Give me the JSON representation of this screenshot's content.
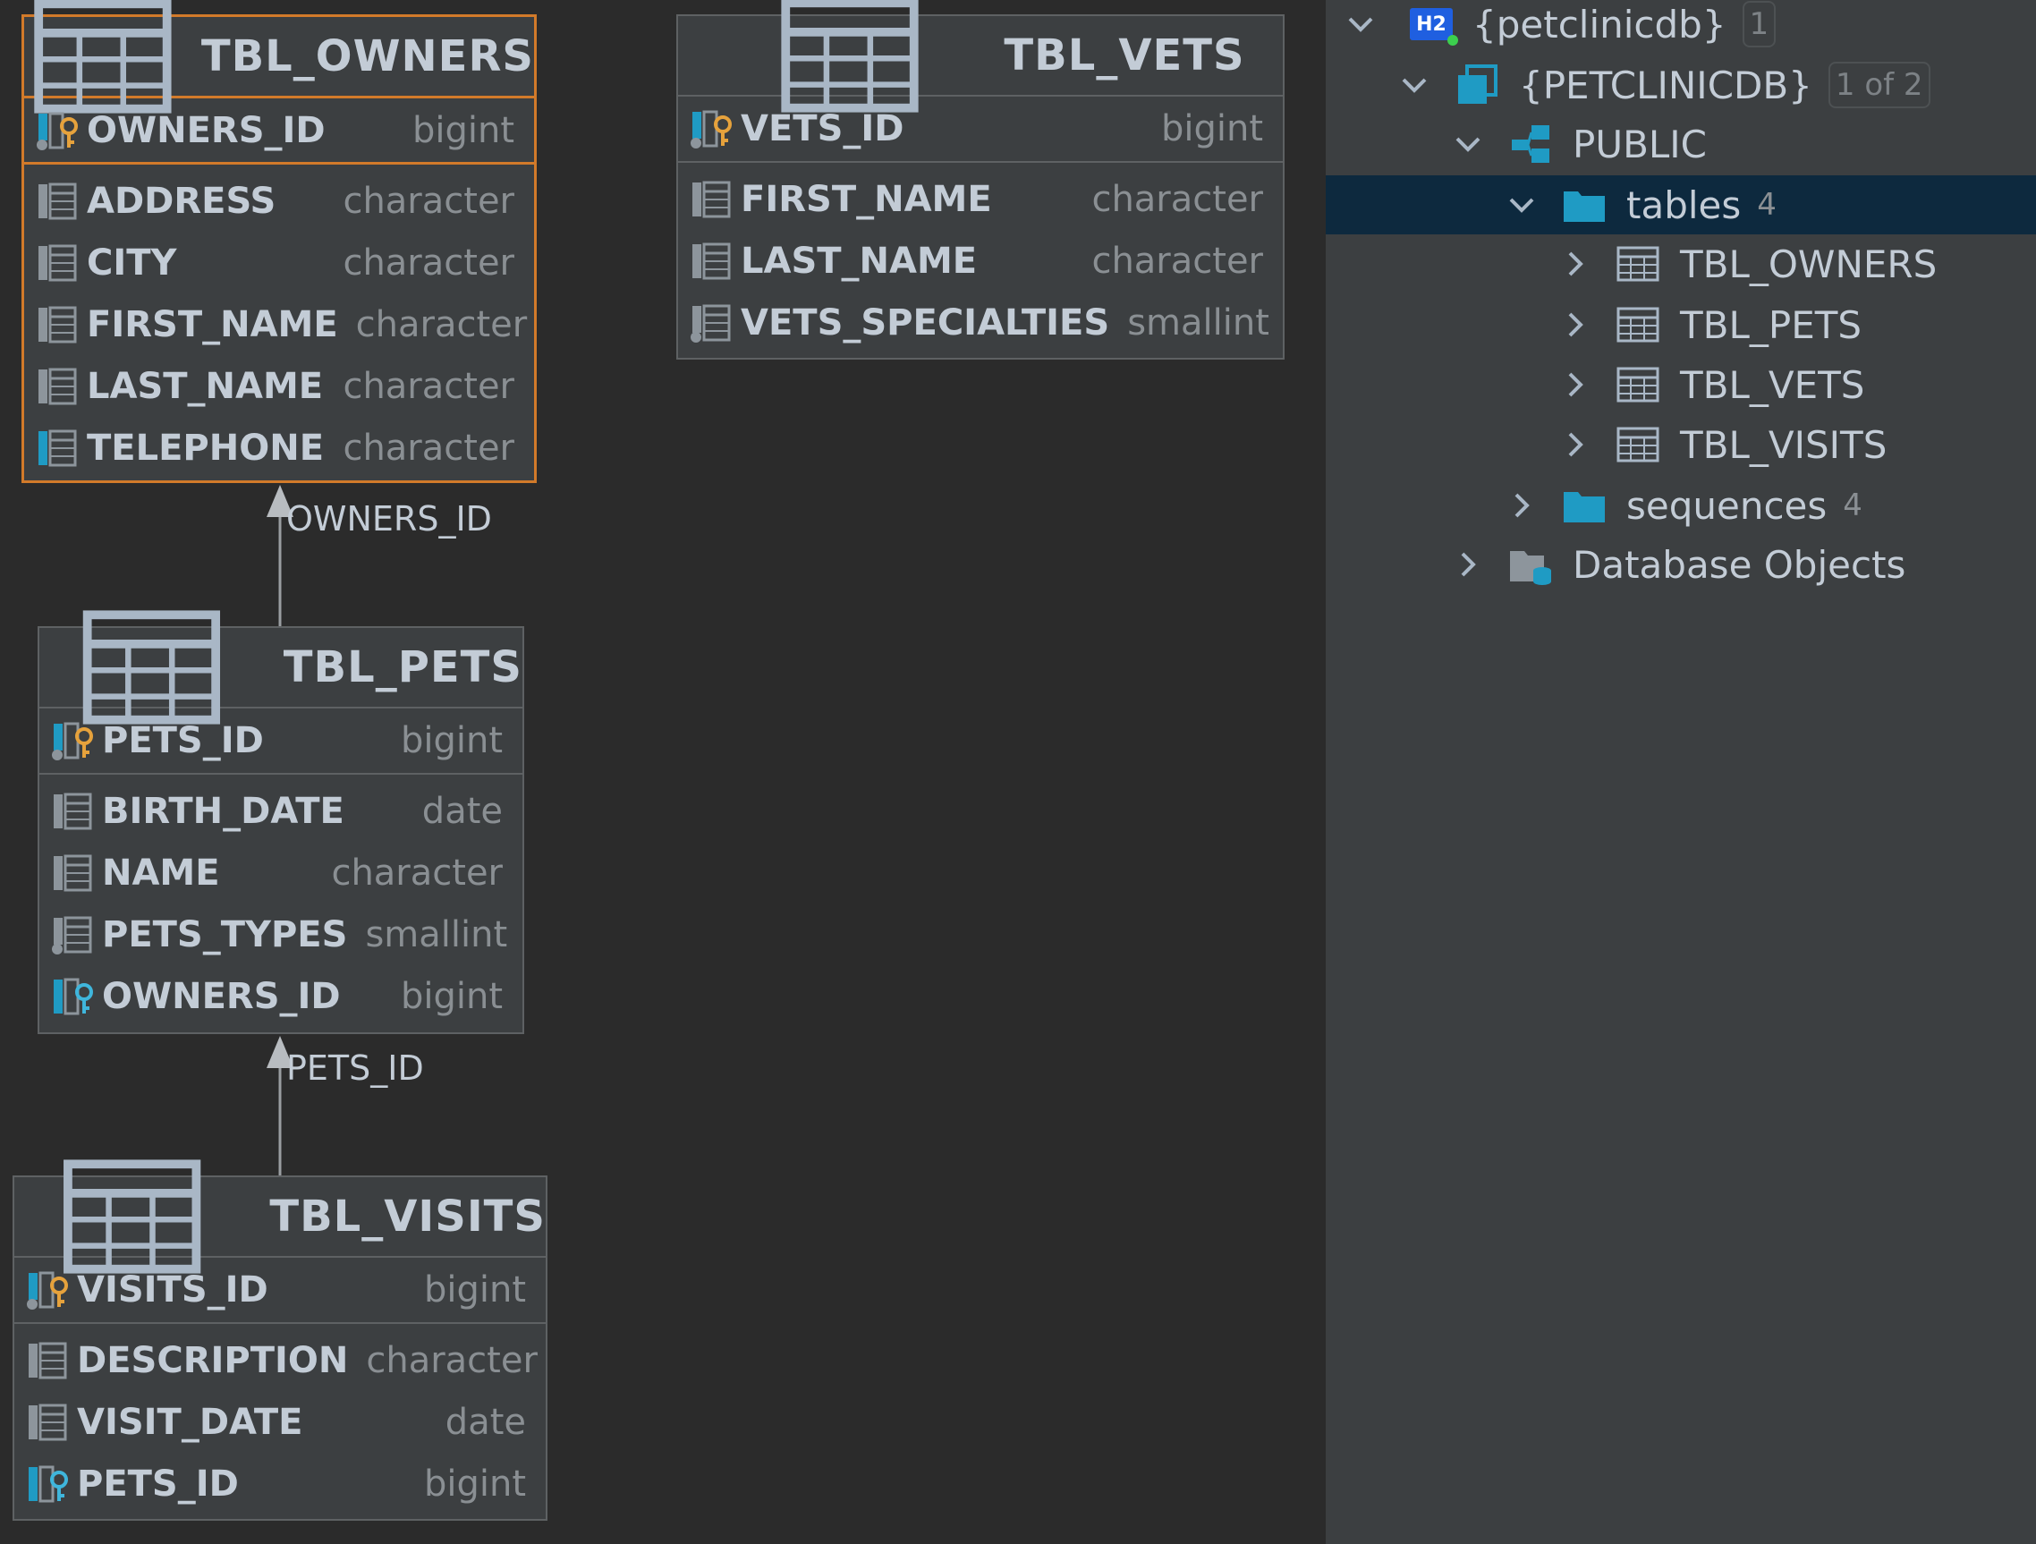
{
  "diagram": {
    "tables": {
      "owners": {
        "title": "TBL_OWNERS",
        "pk": {
          "name": "OWNERS_ID",
          "type": "bigint"
        },
        "columns": [
          {
            "name": "ADDRESS",
            "type": "character"
          },
          {
            "name": "CITY",
            "type": "character"
          },
          {
            "name": "FIRST_NAME",
            "type": "character"
          },
          {
            "name": "LAST_NAME",
            "type": "character"
          },
          {
            "name": "TELEPHONE",
            "type": "character"
          }
        ]
      },
      "vets": {
        "title": "TBL_VETS",
        "pk": {
          "name": "VETS_ID",
          "type": "bigint"
        },
        "columns": [
          {
            "name": "FIRST_NAME",
            "type": "character"
          },
          {
            "name": "LAST_NAME",
            "type": "character"
          },
          {
            "name": "VETS_SPECIALTIES",
            "type": "smallint"
          }
        ]
      },
      "pets": {
        "title": "TBL_PETS",
        "pk": {
          "name": "PETS_ID",
          "type": "bigint"
        },
        "columns": [
          {
            "name": "BIRTH_DATE",
            "type": "date"
          },
          {
            "name": "NAME",
            "type": "character"
          },
          {
            "name": "PETS_TYPES",
            "type": "smallint"
          },
          {
            "name": "OWNERS_ID",
            "type": "bigint"
          }
        ]
      },
      "visits": {
        "title": "TBL_VISITS",
        "pk": {
          "name": "VISITS_ID",
          "type": "bigint"
        },
        "columns": [
          {
            "name": "DESCRIPTION",
            "type": "character"
          },
          {
            "name": "VISIT_DATE",
            "type": "date"
          },
          {
            "name": "PETS_ID",
            "type": "bigint"
          }
        ]
      }
    },
    "edges": {
      "pets_to_owners": "OWNERS_ID",
      "visits_to_pets": "PETS_ID"
    }
  },
  "tree": {
    "root": {
      "label": "{petclinicdb}",
      "count": "1",
      "badge_icon": "H2"
    },
    "schema_db": {
      "label": "{PETCLINICDB}",
      "badge": "1 of 2"
    },
    "public": {
      "label": "PUBLIC"
    },
    "tables": {
      "label": "tables",
      "count": "4"
    },
    "table_items": [
      "TBL_OWNERS",
      "TBL_PETS",
      "TBL_VETS",
      "TBL_VISITS"
    ],
    "sequences": {
      "label": "sequences",
      "count": "4"
    },
    "db_objects": {
      "label": "Database Objects"
    }
  },
  "colors": {
    "background": "#2b2b2b",
    "panel": "#3c3f41",
    "selection": "#0d293e",
    "accent_orange": "#d27a2a",
    "folder_blue": "#1f9bc4",
    "key_gold": "#e6a23c"
  },
  "icons": {
    "table": "table-grid-icon",
    "column": "column-icon",
    "primary_key": "primary-key-icon",
    "foreign_key": "foreign-key-icon",
    "folder": "folder-icon",
    "schema": "schema-icon",
    "database": "database-icon"
  }
}
